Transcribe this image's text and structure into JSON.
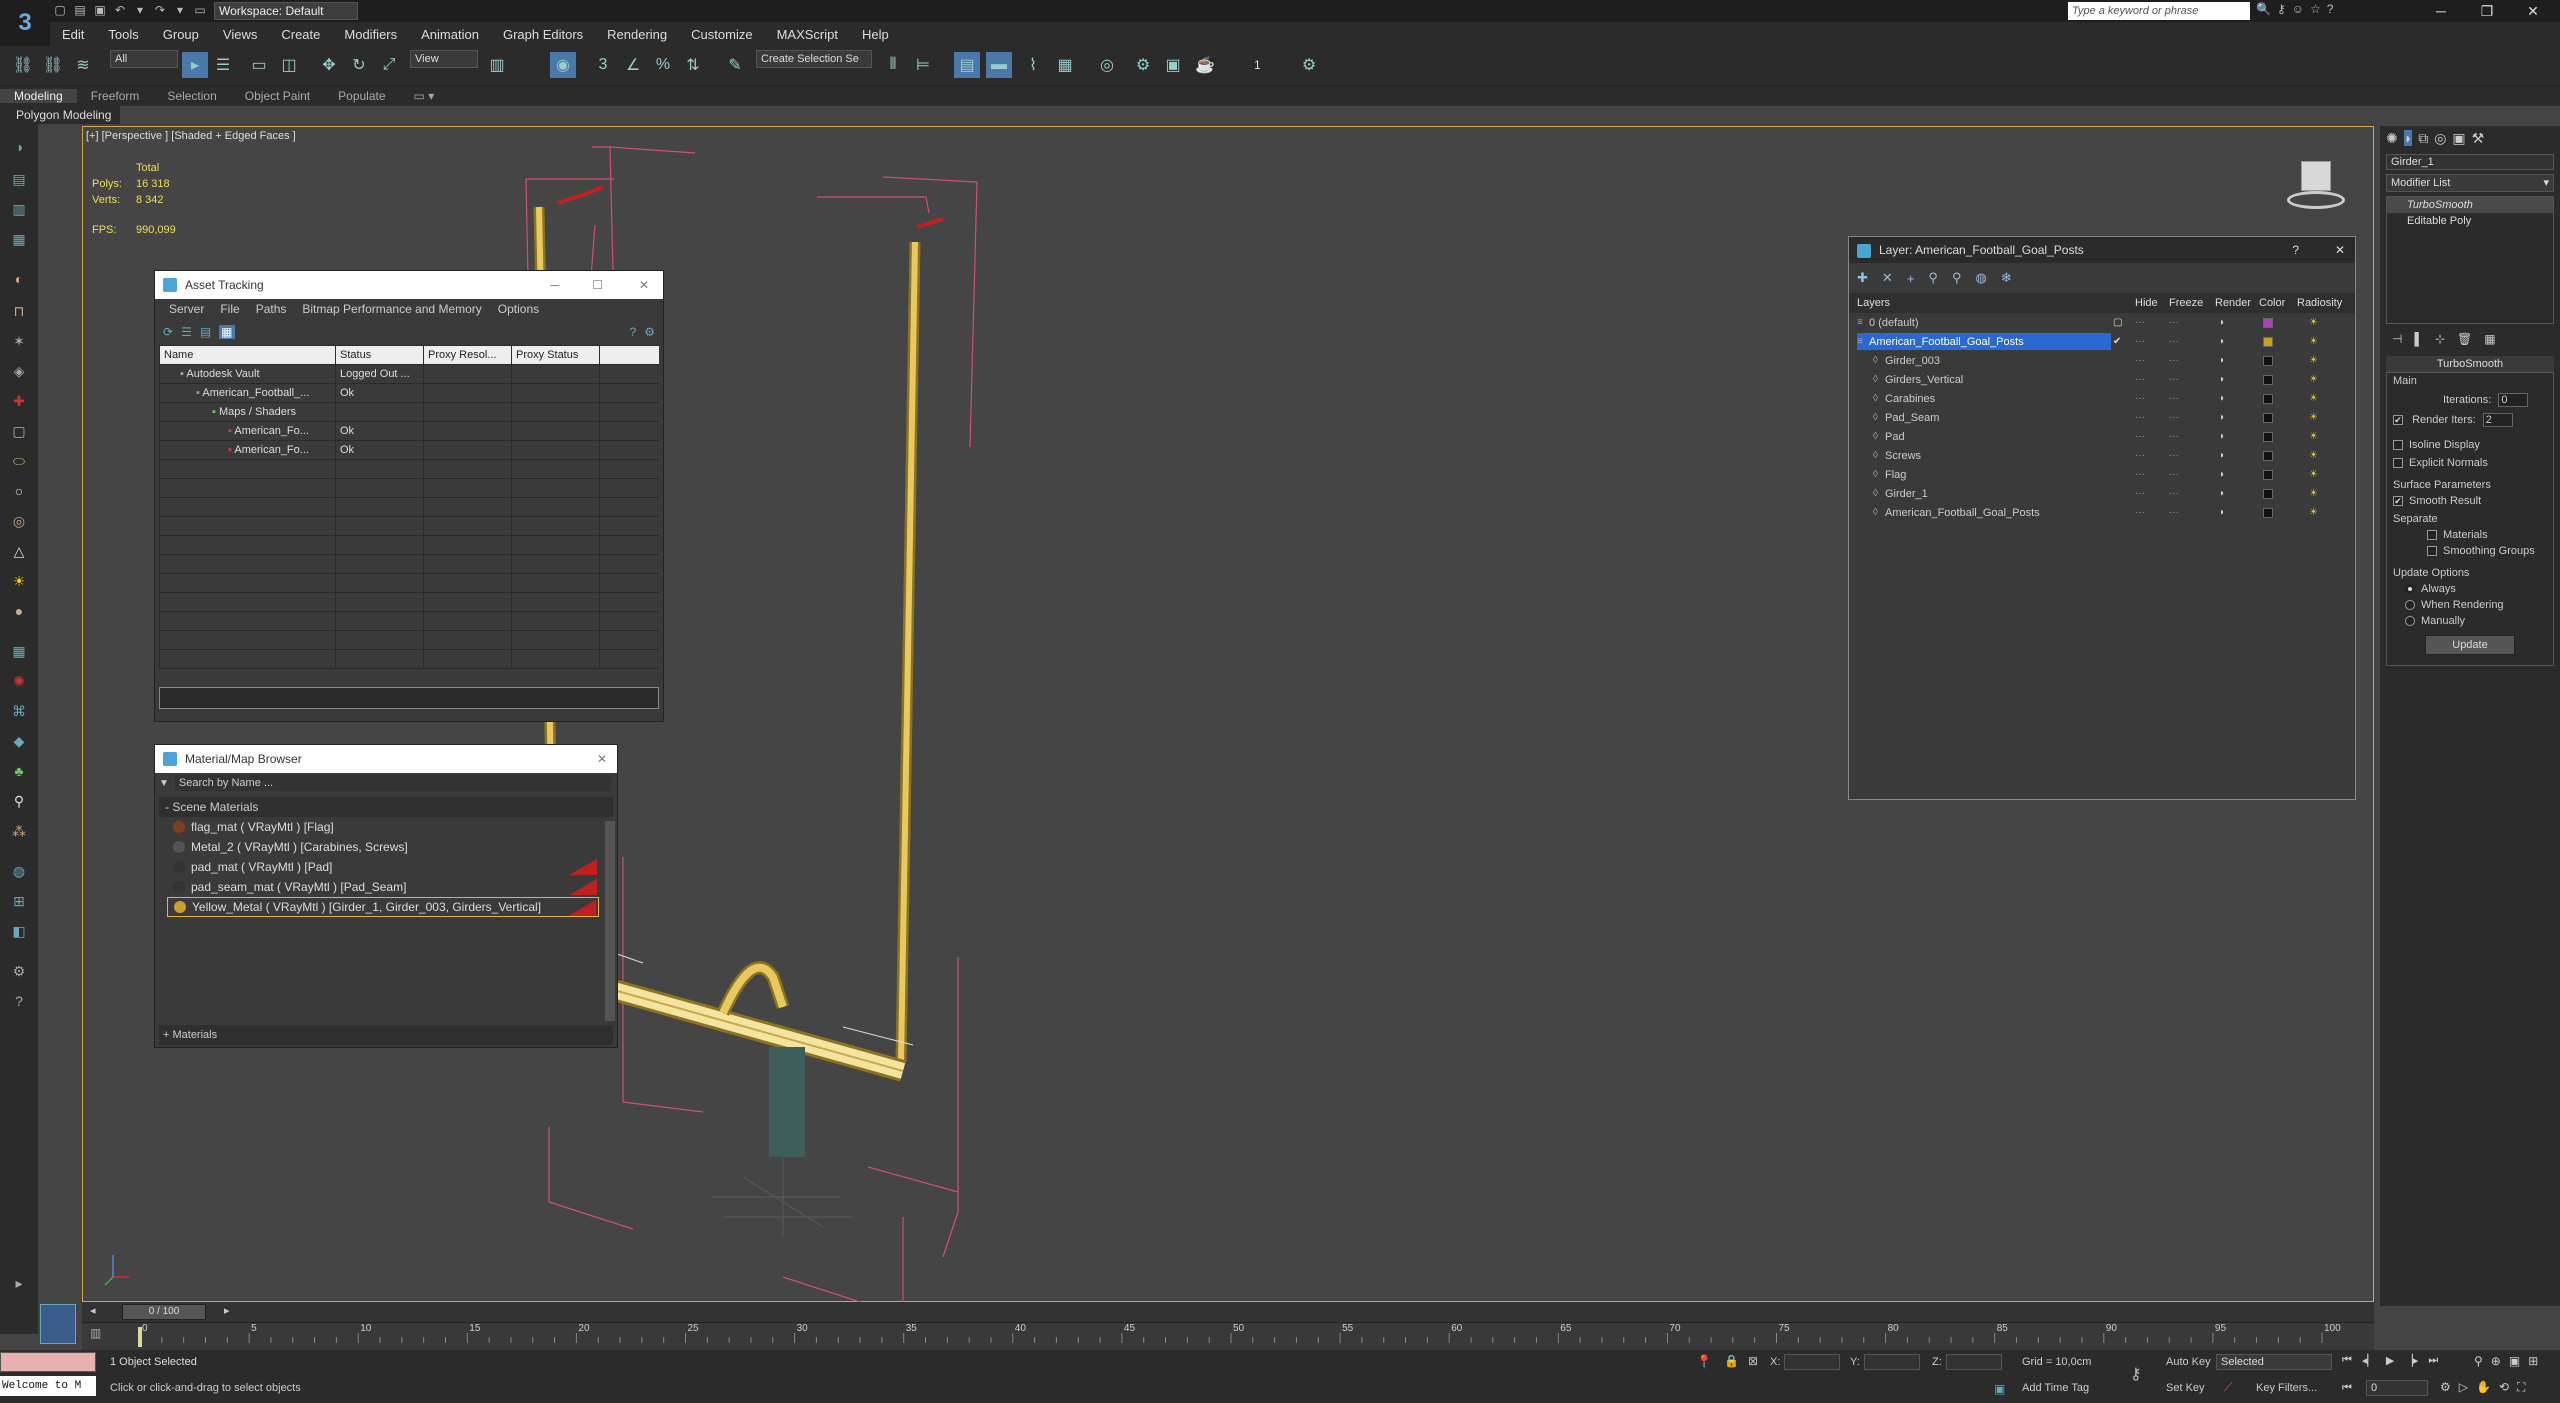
{
  "app": {
    "workspace": "Workspace: Default",
    "search_placeholder": "Type a keyword or phrase",
    "menus": [
      "Edit",
      "Tools",
      "Group",
      "Views",
      "Create",
      "Modifiers",
      "Animation",
      "Graph Editors",
      "Rendering",
      "Customize",
      "MAXScript",
      "Help"
    ]
  },
  "toolbar": {
    "selection_filter": "All",
    "ref_coord": "View",
    "named_selection": "Create Selection Se",
    "counter": "1"
  },
  "ribbon": {
    "tabs": [
      "Modeling",
      "Freeform",
      "Selection",
      "Object Paint",
      "Populate"
    ],
    "sub_label": "Polygon Modeling"
  },
  "viewport": {
    "label": "[+] [Perspective ] [Shaded + Edged Faces ]",
    "stats_header": "Total",
    "polys_label": "Polys:",
    "polys_value": "16 318",
    "verts_label": "Verts:",
    "verts_value": "8 342",
    "fps_label": "FPS:",
    "fps_value": "990,099"
  },
  "asset_tracking": {
    "title": "Asset Tracking",
    "menus": [
      "Server",
      "File",
      "Paths",
      "Bitmap Performance and Memory",
      "Options"
    ],
    "columns": [
      "Name",
      "Status",
      "Proxy Resol...",
      "Proxy Status"
    ],
    "rows": [
      {
        "name": "Autodesk Vault",
        "status": "Logged Out ..."
      },
      {
        "name": "American_Football_...",
        "status": "Ok"
      },
      {
        "name": "Maps / Shaders",
        "status": ""
      },
      {
        "name": "American_Fo...",
        "status": "Ok"
      },
      {
        "name": "American_Fo...",
        "status": "Ok"
      }
    ]
  },
  "material_browser": {
    "title": "Material/Map Browser",
    "search_placeholder": "Search by Name ...",
    "section": "- Scene Materials",
    "materials": [
      "flag_mat ( VRayMtl ) [Flag]",
      "Metal_2 ( VRayMtl ) [Carabines, Screws]",
      "pad_mat ( VRayMtl ) [Pad]",
      "pad_seam_mat ( VRayMtl ) [Pad_Seam]",
      "Yellow_Metal ( VRayMtl ) [Girder_1, Girder_003, Girders_Vertical]"
    ],
    "footer": "+ Materials"
  },
  "layer_window": {
    "title": "Layer: American_Football_Goal_Posts",
    "help": "?",
    "columns": [
      "Layers",
      "Hide",
      "Freeze",
      "Render",
      "Color",
      "Radiosity"
    ],
    "layers": [
      {
        "name": "0 (default)",
        "color": "#b040c0"
      },
      {
        "name": "American_Football_Goal_Posts",
        "color": "#c8a020"
      },
      {
        "name": "Girder_003",
        "color": "#111111"
      },
      {
        "name": "Girders_Vertical",
        "color": "#111111"
      },
      {
        "name": "Carabines",
        "color": "#111111"
      },
      {
        "name": "Pad_Seam",
        "color": "#111111"
      },
      {
        "name": "Pad",
        "color": "#111111"
      },
      {
        "name": "Screws",
        "color": "#111111"
      },
      {
        "name": "Flag",
        "color": "#111111"
      },
      {
        "name": "Girder_1",
        "color": "#111111"
      },
      {
        "name": "American_Football_Goal_Posts",
        "color": "#111111"
      }
    ]
  },
  "command_panel": {
    "object_name": "Girder_1",
    "modifier_list": "Modifier List",
    "stack": [
      "TurboSmooth",
      "Editable Poly"
    ],
    "rollout_title": "TurboSmooth",
    "main_label": "Main",
    "iterations_label": "Iterations:",
    "iterations_value": "0",
    "render_iters_label": "Render Iters:",
    "render_iters_value": "2",
    "isoline": "Isoline Display",
    "explicit_normals": "Explicit Normals",
    "surface_params": "Surface Parameters",
    "smooth_result": "Smooth Result",
    "separate": "Separate",
    "materials": "Materials",
    "smoothing_groups": "Smoothing Groups",
    "update_options": "Update Options",
    "always": "Always",
    "when_rendering": "When Rendering",
    "manually": "Manually",
    "update_button": "Update"
  },
  "timeline": {
    "frame": "0 / 100",
    "ticks": [
      "0",
      "5",
      "10",
      "15",
      "20",
      "25",
      "30",
      "35",
      "40",
      "45",
      "50",
      "55",
      "60",
      "65",
      "70",
      "75",
      "80",
      "85",
      "90",
      "95",
      "100"
    ]
  },
  "status": {
    "maxscript": "Welcome to M",
    "selected": "1 Object Selected",
    "prompt": "Click or click-and-drag to select objects",
    "x_label": "X:",
    "y_label": "Y:",
    "z_label": "Z:",
    "grid": "Grid = 10,0cm",
    "add_time_tag": "Add Time Tag",
    "auto_key": "Auto Key",
    "set_key": "Set Key",
    "selected_dropdown": "Selected",
    "key_filters": "Key Filters...",
    "frame_value": "0"
  }
}
